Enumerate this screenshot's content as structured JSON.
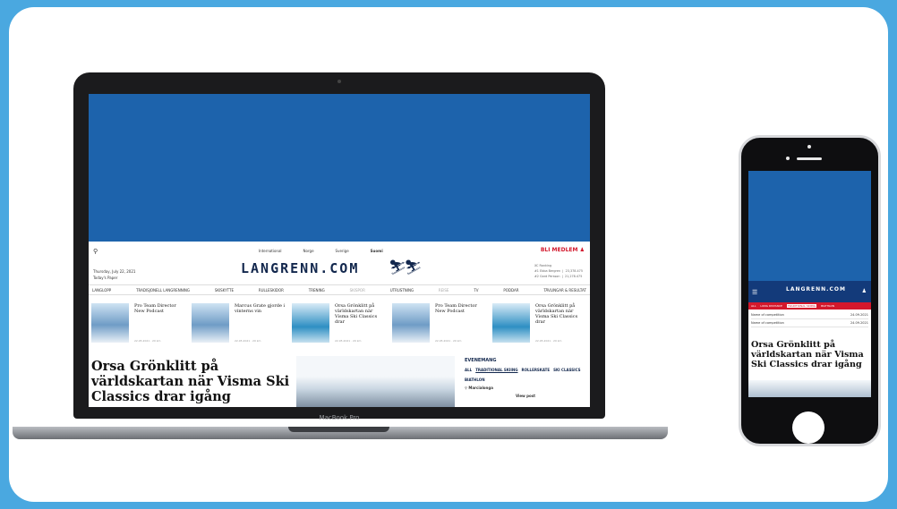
{
  "laptop": {
    "brand_label": "MacBook Pro",
    "site": {
      "search_icon": "search-icon",
      "regions": [
        "International",
        "Norge",
        "Sverige",
        "Suomi"
      ],
      "active_region": "Suomi",
      "join_label": "BLI MEDLEM",
      "date_line": "Thursday, July 22, 2021",
      "paper_line": "Today's Paper",
      "logo_text": "LANGRENN.COM",
      "ranking": {
        "title": "XC Ranking",
        "rows": [
          {
            "rank": "#1",
            "name": "Ebba Bergren",
            "points": "23,378.475"
          },
          {
            "rank": "#2",
            "name": "Gard Persson",
            "points": "21,278.475"
          }
        ]
      },
      "nav": [
        "LANGLOPP",
        "TRADISJONELL LANGRENNING",
        "SKISKYTTE",
        "RULLESKIDOR",
        "TRENING",
        "SKISPOR",
        "UTRUSTNING",
        "REISE",
        "TV",
        "PODDAR",
        "TÄVLINGAR & RESULTAT"
      ],
      "nav_dim": [
        "SKISPOR",
        "REISE"
      ],
      "mini_articles": [
        {
          "title": "Pro Team Director New Podcast",
          "meta": "22.05.2021 · 20 km",
          "style": "blue"
        },
        {
          "title": "Marcus Grate gjorde i vinterns vin",
          "meta": "22.05.2021 · 20 km",
          "style": "blue"
        },
        {
          "title": "Orsa Grönklitt på världskartan när Visma Ski Classics drar",
          "meta": "22.05.2021 · 20 km",
          "style": "green"
        },
        {
          "title": "Pro Team Director New Podcast",
          "meta": "22.05.2021 · 20 km",
          "style": "blue"
        },
        {
          "title": "Orsa Grönklitt på världskartan när Visma Ski Classics drar",
          "meta": "22.05.2021 · 20 km",
          "style": "green"
        }
      ],
      "headline": "Orsa Grönklitt på världskartan när Visma Ski Classics drar igång",
      "events": {
        "title": "EVENEMANG",
        "tags": [
          "ALL",
          "TRADITIONAL SKIING",
          "ROLLERSKATE",
          "SKI CLASSICS",
          "BIATHLON"
        ],
        "active_tag": "TRADITIONAL SKIING",
        "place": "Marcialonga",
        "view_label": "View post"
      }
    }
  },
  "phone": {
    "logo_text": "LANGRENN.COM",
    "tabs": [
      "ALL",
      "LONG DISTANCE",
      "TRADITIONAL SKIING",
      "BIATHLON"
    ],
    "active_tab": "TRADITIONAL SKIING",
    "table_rows": [
      {
        "name": "Name of competition",
        "date": "24.09.2021"
      },
      {
        "name": "Name of competition",
        "date": "24.09.2021"
      }
    ],
    "headline": "Orsa Grönklitt på världskartan när Visma Ski Classics drar igång"
  },
  "colors": {
    "background": "#4aa8e0",
    "brand_blue": "#1d63ac",
    "navy": "#12274d",
    "accent_red": "#d3182c"
  }
}
